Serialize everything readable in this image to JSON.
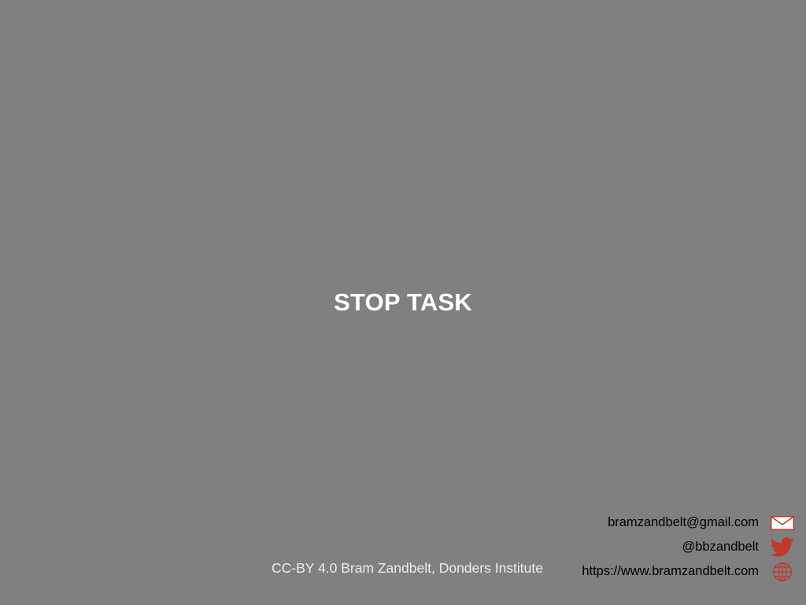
{
  "slide": {
    "title": "STOP TASK",
    "license": "CC-BY 4.0 Bram Zandbelt, Donders Institute"
  },
  "contacts": {
    "email": {
      "text": "bramzandbelt@gmail.com",
      "icon": "envelope-icon"
    },
    "twitter": {
      "text": "@bbzandbelt",
      "icon": "twitter-bird-icon"
    },
    "website": {
      "text": "https://www.bramzandbelt.com",
      "icon": "globe-icon"
    }
  },
  "colors": {
    "background": "#808080",
    "title": "#ffffff",
    "accent": "#c0392b"
  }
}
